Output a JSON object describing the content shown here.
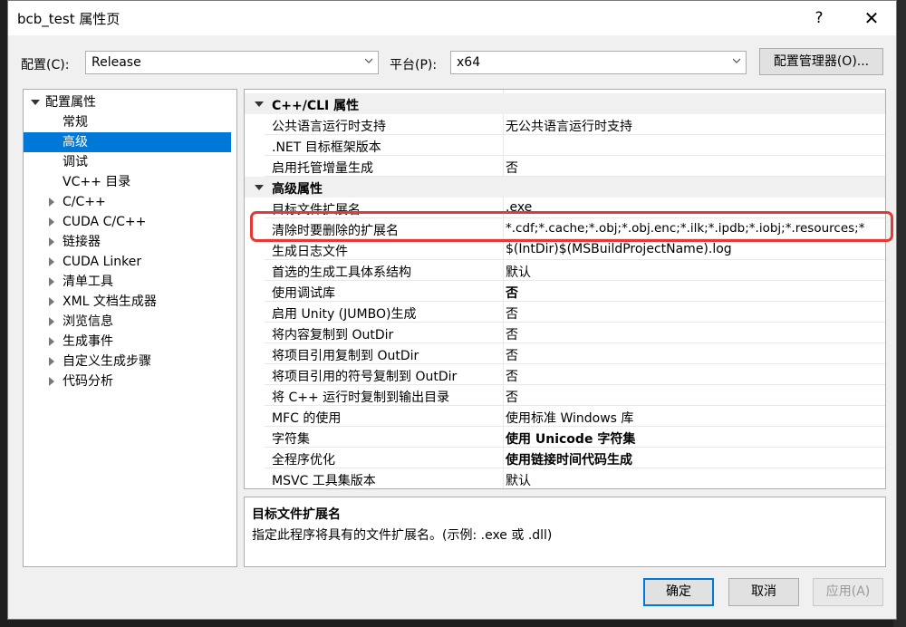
{
  "window": {
    "title": "bcb_test 属性页",
    "help_label": "?",
    "close_label": "✕"
  },
  "config": {
    "label": "配置(C):",
    "value": "Release",
    "platform_label": "平台(P):",
    "platform_value": "x64",
    "manager_label": "配置管理器(O)..."
  },
  "tree": {
    "items": [
      {
        "label": "配置属性",
        "level": 0,
        "expander": "expanded"
      },
      {
        "label": "常规",
        "level": 1,
        "expander": "none"
      },
      {
        "label": "高级",
        "level": 1,
        "expander": "none",
        "selected": true
      },
      {
        "label": "调试",
        "level": 1,
        "expander": "none"
      },
      {
        "label": "VC++ 目录",
        "level": 1,
        "expander": "none"
      },
      {
        "label": "C/C++",
        "level": 1,
        "expander": "collapsed"
      },
      {
        "label": "CUDA C/C++",
        "level": 1,
        "expander": "collapsed"
      },
      {
        "label": "链接器",
        "level": 1,
        "expander": "collapsed"
      },
      {
        "label": "CUDA Linker",
        "level": 1,
        "expander": "collapsed"
      },
      {
        "label": "清单工具",
        "level": 1,
        "expander": "collapsed"
      },
      {
        "label": "XML 文档生成器",
        "level": 1,
        "expander": "collapsed"
      },
      {
        "label": "浏览信息",
        "level": 1,
        "expander": "collapsed"
      },
      {
        "label": "生成事件",
        "level": 1,
        "expander": "collapsed"
      },
      {
        "label": "自定义生成步骤",
        "level": 1,
        "expander": "collapsed"
      },
      {
        "label": "代码分析",
        "level": 1,
        "expander": "collapsed"
      }
    ]
  },
  "grid": {
    "categories": [
      {
        "name": "C++/CLI 属性",
        "rows": [
          {
            "key": "公共语言运行时支持",
            "value": "无公共语言运行时支持",
            "bold": false
          },
          {
            "key": ".NET 目标框架版本",
            "value": "",
            "bold": false
          },
          {
            "key": "启用托管增量生成",
            "value": "否",
            "bold": false
          }
        ]
      },
      {
        "name": "高级属性",
        "rows": [
          {
            "key": "目标文件扩展名",
            "value": ".exe",
            "bold": false
          },
          {
            "key": "清除时要删除的扩展名",
            "value": "*.cdf;*.cache;*.obj;*.obj.enc;*.ilk;*.ipdb;*.iobj;*.resources;*",
            "bold": false
          },
          {
            "key": "生成日志文件",
            "value": "$(IntDir)$(MSBuildProjectName).log",
            "bold": false
          },
          {
            "key": "首选的生成工具体系结构",
            "value": "默认",
            "bold": false
          },
          {
            "key": "使用调试库",
            "value": "否",
            "bold": true
          },
          {
            "key": "启用 Unity (JUMBO)生成",
            "value": "否",
            "bold": false
          },
          {
            "key": "将内容复制到 OutDir",
            "value": "否",
            "bold": false
          },
          {
            "key": "将项目引用复制到 OutDir",
            "value": "否",
            "bold": false
          },
          {
            "key": "将项目引用的符号复制到 OutDir",
            "value": "否",
            "bold": false
          },
          {
            "key": "将 C++ 运行时复制到输出目录",
            "value": "否",
            "bold": false
          },
          {
            "key": "MFC 的使用",
            "value": "使用标准 Windows 库",
            "bold": false
          },
          {
            "key": "字符集",
            "value": "使用 Unicode 字符集",
            "bold": true
          },
          {
            "key": "全程序优化",
            "value": "使用链接时间代码生成",
            "bold": true
          },
          {
            "key": "MSVC 工具集版本",
            "value": "默认",
            "bold": false
          }
        ]
      }
    ]
  },
  "description": {
    "title": "目标文件扩展名",
    "text": "指定此程序将具有的文件扩展名。(示例: .exe 或 .dll)"
  },
  "buttons": {
    "ok": "确定",
    "cancel": "取消",
    "apply": "应用(A)"
  },
  "colors": {
    "selection": "#0078d7",
    "highlight_annotation": "#e53935"
  }
}
